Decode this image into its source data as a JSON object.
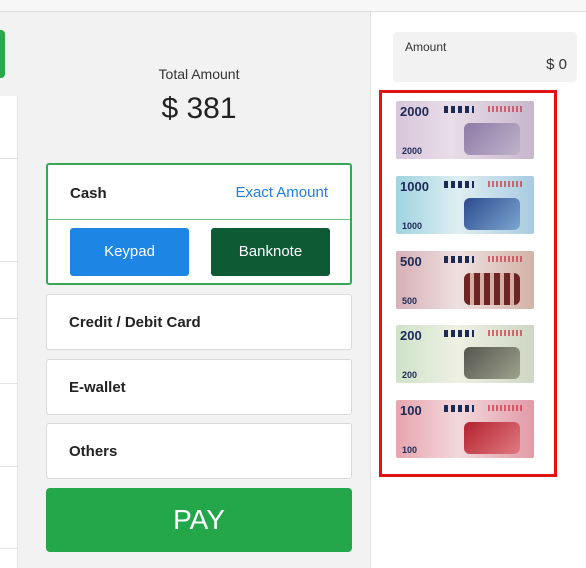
{
  "total": {
    "label": "Total Amount",
    "value": "$ 381"
  },
  "payment_methods": {
    "cash": {
      "label": "Cash",
      "exact_amount_label": "Exact Amount",
      "keypad_label": "Keypad",
      "banknote_label": "Banknote"
    },
    "credit_debit_label": "Credit / Debit Card",
    "ewallet_label": "E-wallet",
    "others_label": "Others"
  },
  "pay_button_label": "PAY",
  "amount_panel": {
    "label": "Amount",
    "value": "$ 0"
  },
  "banknotes": [
    {
      "denomination": "2000",
      "small": "2000"
    },
    {
      "denomination": "1000",
      "small": "1000"
    },
    {
      "denomination": "500",
      "small": "500"
    },
    {
      "denomination": "200",
      "small": "200"
    },
    {
      "denomination": "100",
      "small": "100"
    }
  ],
  "colors": {
    "accent_green": "#23a74a",
    "keypad_blue": "#1d86e5",
    "banknote_dark_green": "#0d5a35",
    "link_blue": "#1f7fe0",
    "highlight_red": "#e01414"
  }
}
